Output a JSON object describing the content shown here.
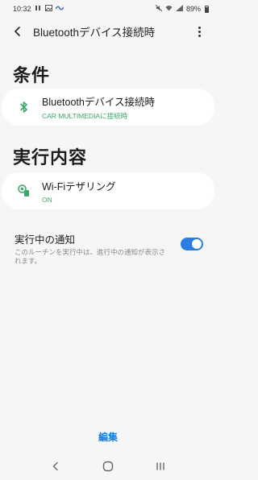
{
  "status_bar": {
    "time": "10:32",
    "battery": "89%"
  },
  "header": {
    "title": "Bluetoothデバイス接続時"
  },
  "conditions": {
    "heading": "条件",
    "card": {
      "title": "Bluetoothデバイス接続時",
      "subtitle": "CAR MULTIMEDIAに接続時",
      "icon": "bluetooth-icon"
    }
  },
  "actions": {
    "heading": "実行内容",
    "card": {
      "title": "Wi-Fiテザリング",
      "subtitle": "ON",
      "icon": "wifi-hotspot-icon"
    }
  },
  "notification": {
    "title": "実行中の通知",
    "description": "このルーチンを実行中は、進行中の通知が表示されます。",
    "toggle_on": true
  },
  "footer": {
    "edit_label": "編集"
  },
  "colors": {
    "accent": "#2a7de1",
    "status_green": "#3aa86b",
    "edit_blue": "#1a7fd6",
    "background": "#f6f6f6"
  }
}
